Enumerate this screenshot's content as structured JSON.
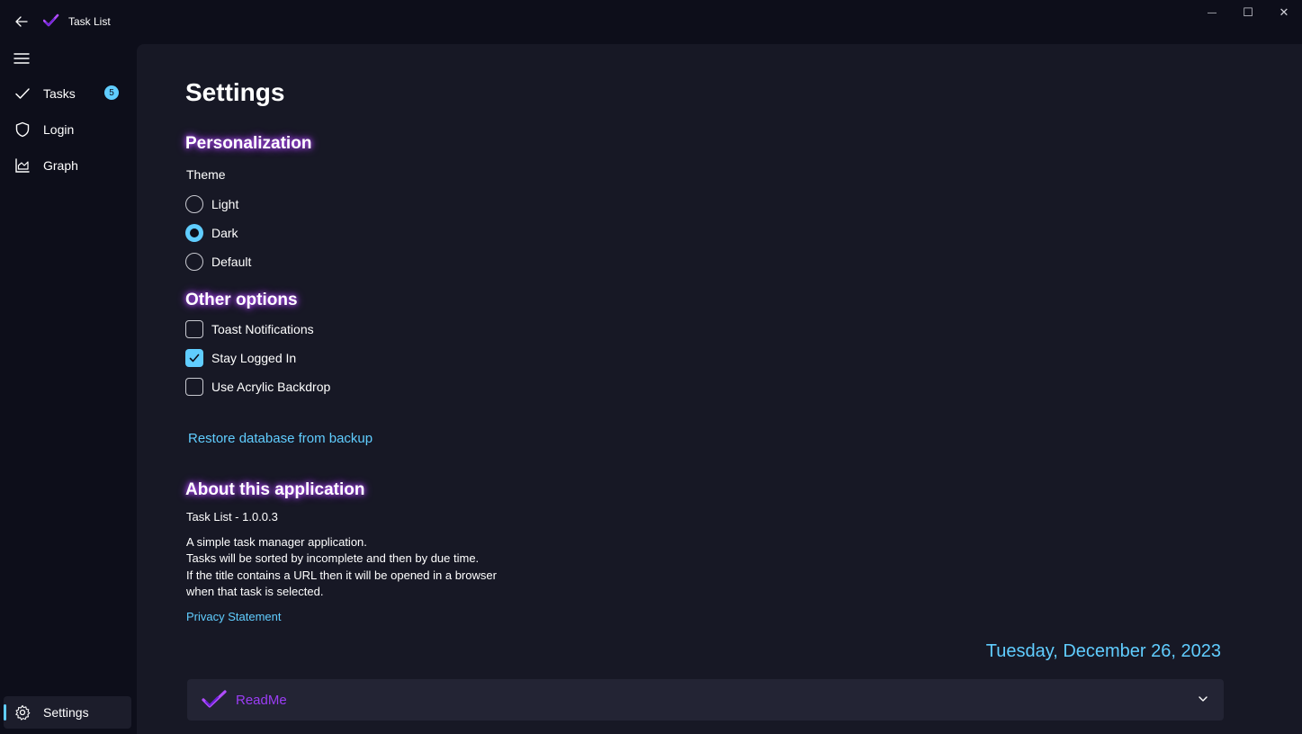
{
  "window": {
    "title": "Task List",
    "minimize_glyph": "—",
    "maximize_glyph": "☐",
    "close_glyph": "✕"
  },
  "nav": {
    "items": [
      {
        "label": "Tasks",
        "icon": "checkmark-icon",
        "badge": "5"
      },
      {
        "label": "Login",
        "icon": "shield-icon"
      },
      {
        "label": "Graph",
        "icon": "chart-icon"
      }
    ],
    "footer": {
      "label": "Settings",
      "icon": "gear-icon",
      "selected": true
    }
  },
  "settings": {
    "title": "Settings",
    "personalization": {
      "heading": "Personalization",
      "theme_label": "Theme",
      "options": [
        {
          "label": "Light",
          "selected": false
        },
        {
          "label": "Dark",
          "selected": true
        },
        {
          "label": "Default",
          "selected": false
        }
      ]
    },
    "other": {
      "heading": "Other options",
      "options": [
        {
          "label": "Toast Notifications",
          "checked": false
        },
        {
          "label": "Stay Logged In",
          "checked": true
        },
        {
          "label": "Use Acrylic Backdrop",
          "checked": false
        }
      ]
    },
    "restore_link": "Restore database from backup",
    "about": {
      "heading": "About this application",
      "version": "Task List - 1.0.0.3",
      "description_lines": [
        "A simple task manager application.",
        "Tasks will be sorted by incomplete and then by due time.",
        "If the title contains a URL then it will be opened in a browser",
        "when that task is selected."
      ],
      "privacy_link": "Privacy Statement"
    },
    "date": "Tuesday, December 26, 2023",
    "expander": {
      "label": "ReadMe"
    }
  },
  "colors": {
    "accent": "#60cdff",
    "purple": "#9b3df5",
    "background": "#0d0e1a",
    "content_bg": "#171825"
  }
}
